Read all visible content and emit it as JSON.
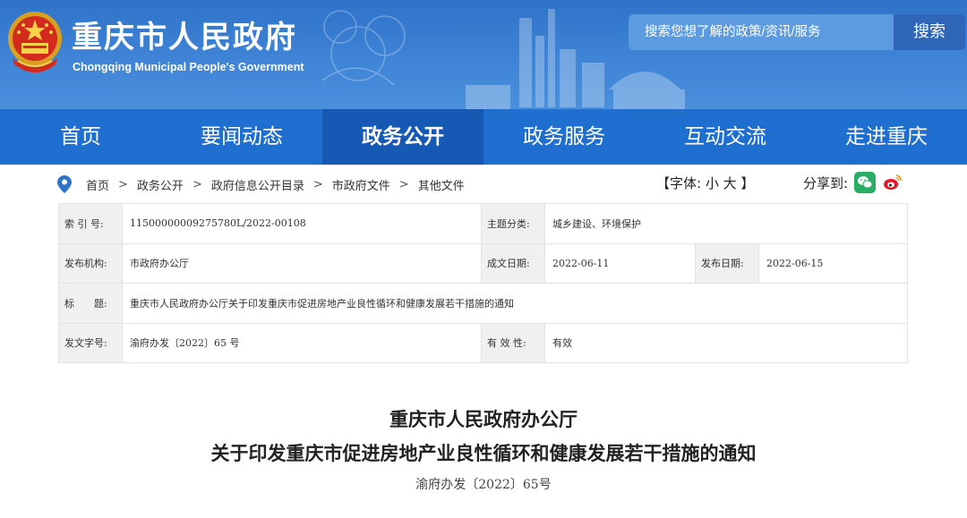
{
  "header": {
    "title": "重庆市人民政府",
    "subtitle": "Chongqing Municipal People's Government",
    "search_placeholder": "搜索您想了解的政策/资讯/服务",
    "search_button": "搜索"
  },
  "nav": {
    "items": [
      {
        "label": "首页"
      },
      {
        "label": "要闻动态"
      },
      {
        "label": "政务公开",
        "active": true
      },
      {
        "label": "政务服务"
      },
      {
        "label": "互动交流"
      },
      {
        "label": "走进重庆"
      }
    ]
  },
  "breadcrumb": {
    "items": [
      "首页",
      "政务公开",
      "政府信息公开目录",
      "市政府文件",
      "其他文件"
    ],
    "separator": ">"
  },
  "font_size": {
    "open": "【字体:",
    "small": "小",
    "large": "大",
    "close": "】"
  },
  "share": {
    "label": "分享到:",
    "icons": [
      "wechat-icon",
      "weibo-icon"
    ]
  },
  "info": {
    "index_label": "索 引 号:",
    "index_value": "11500000009275780L/2022-00108",
    "topic_label": "主题分类:",
    "topic_value": "城乡建设、环境保护",
    "org_label": "发布机构:",
    "org_value": "市政府办公厅",
    "date_label": "成文日期:",
    "date_value": "2022-06-11",
    "pub_label": "发布日期:",
    "pub_value": "2022-06-15",
    "title_label": "标　　题:",
    "title_value": "重庆市人民政府办公厅关于印发重庆市促进房地产业良性循环和健康发展若干措施的通知",
    "docno_label": "发文字号:",
    "docno_value": "渝府办发〔2022〕65 号",
    "valid_label": "有 效 性:",
    "valid_value": "有效"
  },
  "document": {
    "issuer": "重庆市人民政府办公厅",
    "title": "关于印发重庆市促进房地产业良性循环和健康发展若干措施的通知",
    "number": "渝府办发〔2022〕65号"
  },
  "colors": {
    "header_blue": "#3f84d6",
    "nav_blue": "#1f6fd1",
    "nav_active": "#1559b5",
    "search_button": "#2f66b8",
    "wechat_green": "#2aae67",
    "weibo_red": "#e6162d"
  }
}
